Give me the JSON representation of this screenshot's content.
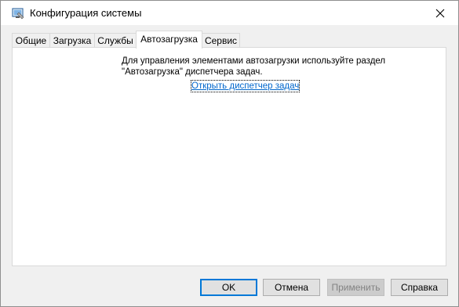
{
  "window": {
    "title": "Конфигурация системы",
    "app_icon": "system-config-icon",
    "close_icon": "close-icon"
  },
  "tabs": [
    {
      "label": "Общие",
      "active": false
    },
    {
      "label": "Загрузка",
      "active": false
    },
    {
      "label": "Службы",
      "active": false
    },
    {
      "label": "Автозагрузка",
      "active": true
    },
    {
      "label": "Сервис",
      "active": false
    }
  ],
  "startup_tab": {
    "message_line1": "Для управления элементами автозагрузки используйте раздел",
    "message_line2": "\"Автозагрузка\" диспетчера задач.",
    "link_label": "Открыть диспетчер задач"
  },
  "buttons": {
    "ok": "OK",
    "cancel": "Отмена",
    "apply": "Применить",
    "help": "Справка"
  },
  "colors": {
    "link": "#0066cc",
    "default_button_border": "#0078d7",
    "dialog_background": "#f0f0f0"
  }
}
